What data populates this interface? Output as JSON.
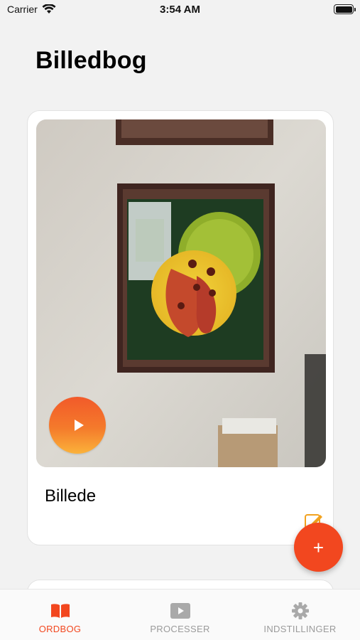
{
  "status_bar": {
    "carrier": "Carrier",
    "time": "3:54 AM"
  },
  "page": {
    "title": "Billedbog"
  },
  "card": {
    "label": "Billede",
    "image_icon": "photo-of-framed-painting",
    "play_icon": "play-icon",
    "edit_icon": "edit-icon"
  },
  "fab": {
    "label": "+",
    "icon": "plus-icon"
  },
  "tabs": [
    {
      "label": "ORDBOG",
      "icon": "book-icon",
      "active": true
    },
    {
      "label": "PROCESSER",
      "icon": "video-play-icon",
      "active": false
    },
    {
      "label": "INDSTILLINGER",
      "icon": "gear-icon",
      "active": false
    }
  ],
  "colors": {
    "accent": "#f2471f",
    "play_gradient_top": "#f25a2a",
    "play_gradient_bottom": "#fbb23a",
    "background": "#f2f2f2",
    "inactive_tab": "#9b9b9b"
  }
}
